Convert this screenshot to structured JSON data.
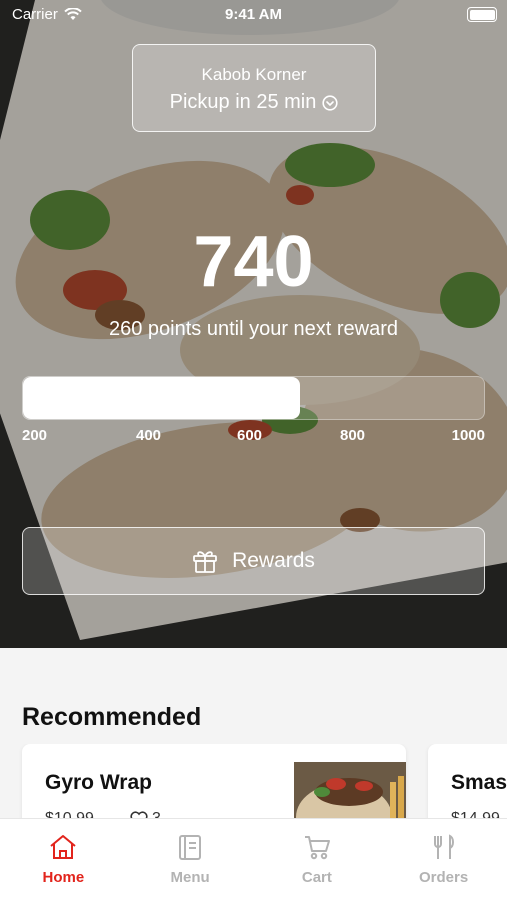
{
  "status_bar": {
    "carrier": "Carrier",
    "time": "9:41 AM"
  },
  "location": {
    "store": "Kabob Korner",
    "pickup": "Pickup in 25 min"
  },
  "loyalty": {
    "points": "740",
    "subtitle": "260 points until your next reward",
    "progress_fraction": 0.6,
    "ticks": [
      "200",
      "400",
      "600",
      "800",
      "1000"
    ]
  },
  "rewards_button": {
    "label": "Rewards",
    "icon": "gift-icon"
  },
  "recommended": {
    "title": "Recommended",
    "items": [
      {
        "name": "Gyro Wrap",
        "price": "$10.99",
        "likes": "3"
      },
      {
        "name": "Smas",
        "price": "$14.99"
      }
    ]
  },
  "tabs": [
    {
      "label": "Home",
      "icon": "home-icon",
      "active": true
    },
    {
      "label": "Menu",
      "icon": "menu-icon",
      "active": false
    },
    {
      "label": "Cart",
      "icon": "cart-icon",
      "active": false
    },
    {
      "label": "Orders",
      "icon": "orders-icon",
      "active": false
    }
  ],
  "colors": {
    "accent": "#e2241c",
    "inactive_tab": "#b3b3b3"
  }
}
